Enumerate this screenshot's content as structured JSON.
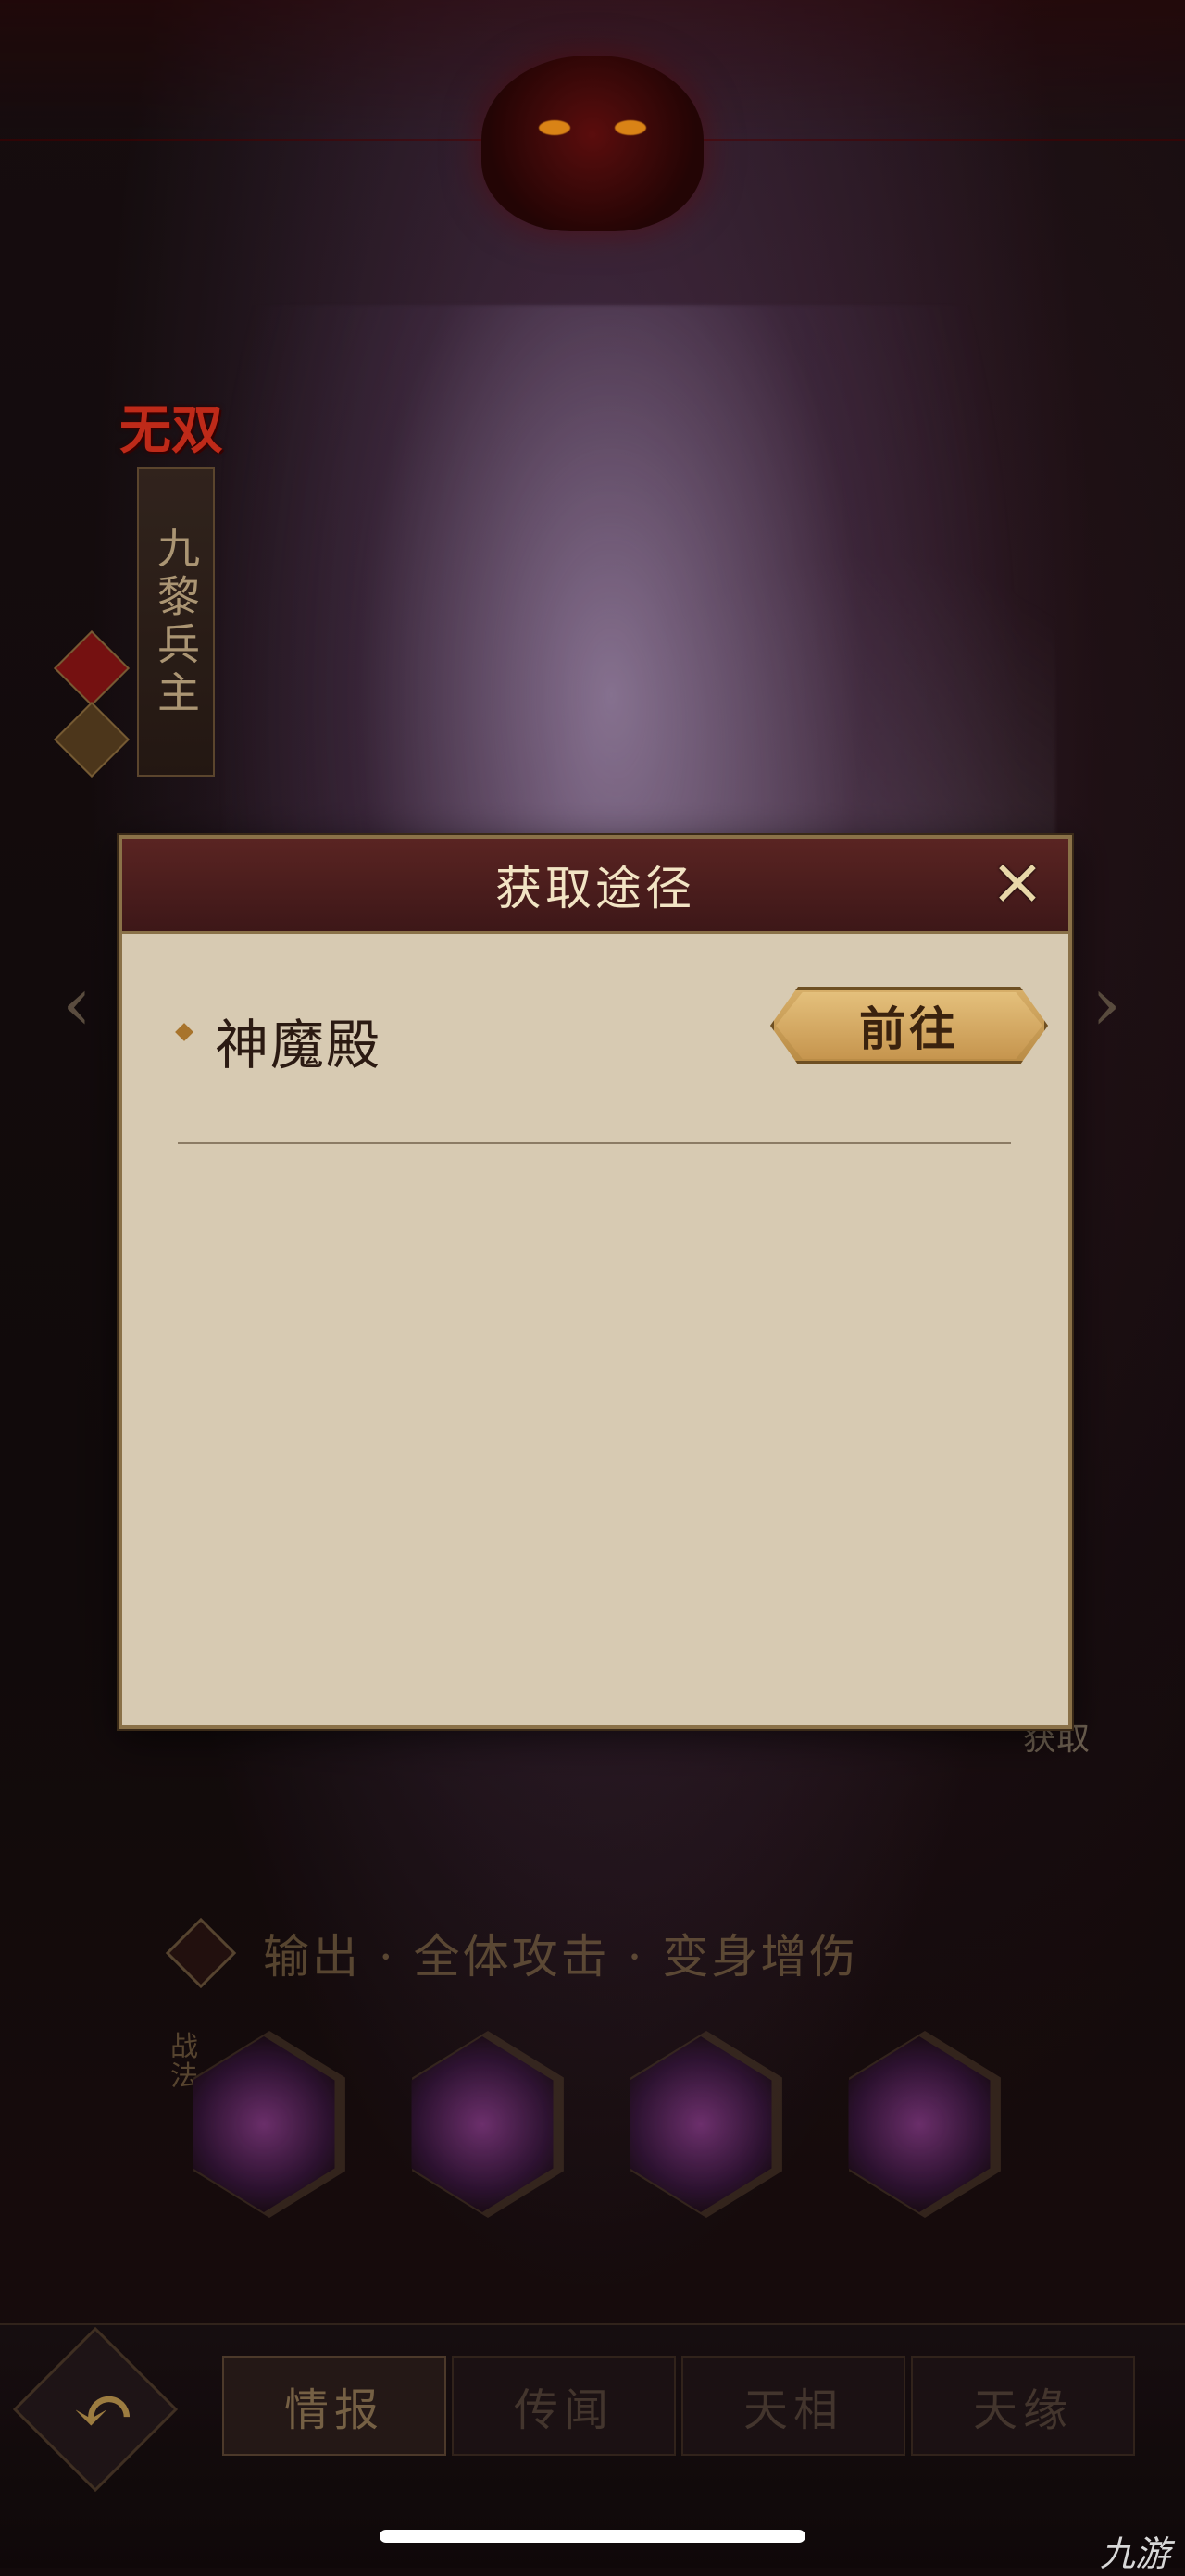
{
  "hero": {
    "badge": "无双",
    "name": "九黎兵主"
  },
  "modal": {
    "title": "获取途径",
    "close_icon": "×",
    "sources": [
      {
        "name": "神魔殿",
        "button_label": "前往"
      }
    ]
  },
  "side_label": "获取",
  "tagline": "输出 · 全体攻击 · 变身增伤",
  "skill_tag": "战法",
  "skills": [
    "skill-1-icon",
    "skill-2-icon",
    "skill-3-icon",
    "skill-4-icon"
  ],
  "tabs": [
    {
      "label": "情报",
      "active": true
    },
    {
      "label": "传闻",
      "active": false
    },
    {
      "label": "天相",
      "active": false
    },
    {
      "label": "天缘",
      "active": false
    }
  ],
  "back_icon": "↶",
  "nav": {
    "left_arrow": "‹",
    "right_arrow": "›"
  },
  "watermark": "九游"
}
